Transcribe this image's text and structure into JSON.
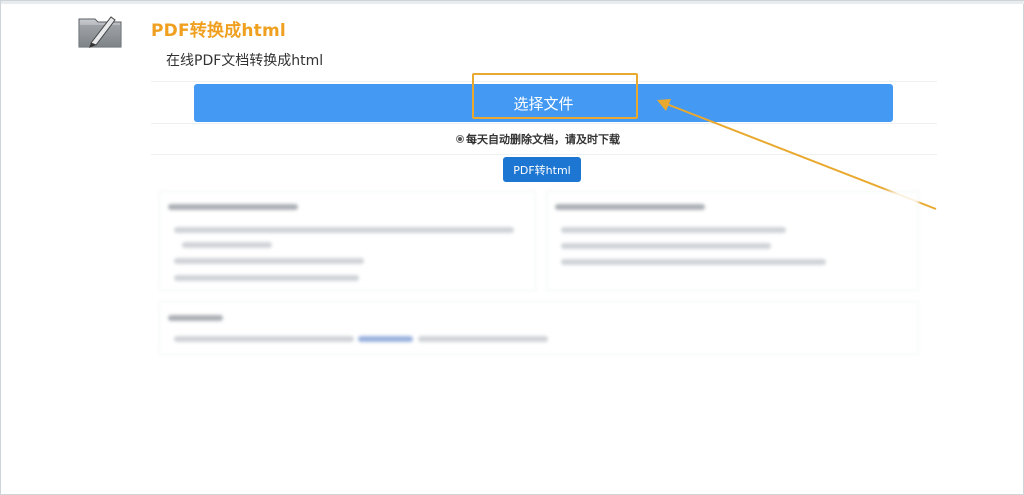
{
  "header": {
    "title": "PDF转换成html",
    "subtitle": "在线PDF文档转换成html",
    "icon": "pdf-pen-icon"
  },
  "upload": {
    "select_file_label": "选择文件",
    "notice": "每天自动删除文档，请及时下载",
    "convert_label": "PDF转html"
  },
  "colors": {
    "title": "#f0a020",
    "select_button": "#4499f3",
    "convert_button": "#1d76d1",
    "annotation": "#e9a92f"
  }
}
